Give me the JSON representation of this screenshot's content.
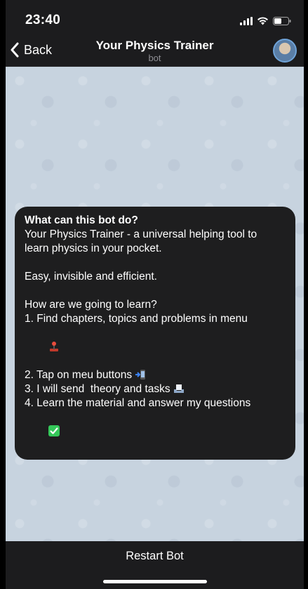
{
  "status_bar": {
    "time": "23:40"
  },
  "nav": {
    "back_label": "Back",
    "title": "Your Physics Trainer",
    "subtitle": "bot"
  },
  "card": {
    "title": "What can this bot do?",
    "intro_1": "Your Physics Trainer - a universal helping tool to",
    "intro_2": "learn physics in your pocket.",
    "tagline": "Easy, invisible and efficient.",
    "question": "How are we going to learn?",
    "step_1a": "1. Find chapters, topics and problems in menu",
    "step_2": "2. Tap on meu buttons",
    "step_3": "3. I will send  theory and tasks",
    "step_4": "4. Learn the material and answer my questions"
  },
  "bottom_bar": {
    "restart_label": "Restart Bot"
  },
  "colors": {
    "bar_bg": "#1c1c1e",
    "chat_bg": "#c7d3df",
    "card_bg": "#1e1e1f",
    "accent_blue": "#6fa3d8",
    "check_green": "#34c759"
  },
  "icons": {
    "back": "chevron-left-icon",
    "signal": "signal-icon",
    "wifi": "wifi-icon",
    "battery": "battery-icon",
    "joystick": "joystick-icon",
    "phone_arrow": "phone-arrow-icon",
    "inbox": "inbox-tray-icon",
    "check": "check-mark-icon"
  }
}
